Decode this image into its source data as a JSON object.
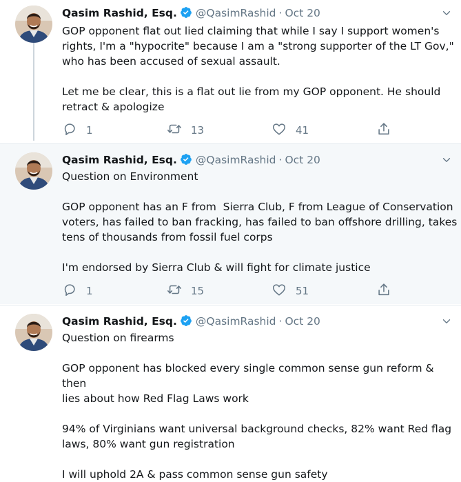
{
  "tweets": [
    {
      "author_name": "Qasim Rashid, Esq.",
      "handle": "@QasimRashid",
      "separator": "·",
      "date": "Oct 20",
      "text": "GOP opponent flat out lied claiming that while I say I support women's\nrights, I'm a \"hypocrite\" because I am a \"strong supporter of the LT Gov,\"\nwho has been accused of sexual assault.\n\nLet me be clear, this is a flat out lie from my GOP opponent. He should\nretract & apologize",
      "replies": "1",
      "retweets": "13",
      "likes": "41"
    },
    {
      "author_name": "Qasim Rashid, Esq.",
      "handle": "@QasimRashid",
      "separator": "·",
      "date": "Oct 20",
      "text": "Question on Environment\n\nGOP opponent has an F from  Sierra Club, F from League of Conservation\nvoters, has failed to ban fracking, has failed to ban offshore drilling, takes\ntens of thousands from fossil fuel corps\n\nI'm endorsed by Sierra Club & will fight for climate justice",
      "replies": "1",
      "retweets": "15",
      "likes": "51"
    },
    {
      "author_name": "Qasim Rashid, Esq.",
      "handle": "@QasimRashid",
      "separator": "·",
      "date": "Oct 20",
      "text": "Question on firearms\n\nGOP opponent has blocked every single common sense gun reform & then\nlies about how Red Flag Laws work\n\n94% of Virginians want universal background checks, 82% want Red flag\nlaws, 80% want gun registration\n\nI will uphold 2A & pass common sense gun safety"
    }
  ],
  "icons": {
    "verified": "verified-badge-icon",
    "caret": "chevron-down-icon",
    "reply": "reply-icon",
    "retweet": "retweet-icon",
    "like": "heart-icon",
    "share": "share-icon"
  },
  "colors": {
    "verified": "#1da1f2",
    "secondary_text": "#657786",
    "highlight_bg": "#f5f8fa",
    "thread_line": "#cdd5dc"
  }
}
